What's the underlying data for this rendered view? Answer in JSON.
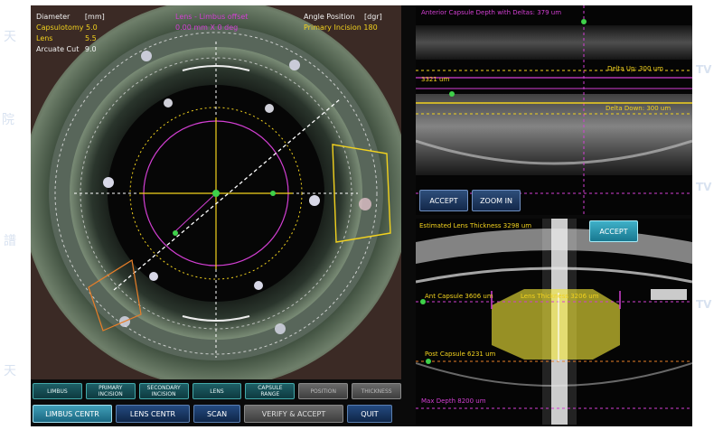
{
  "overlay": {
    "left": {
      "diameter_label": "Diameter",
      "diameter_unit": "[mm]",
      "capsulotomy": "Capsulotomy 5.0",
      "lens_label": "Lens",
      "lens_value": "5.5",
      "arcuate_label": "Arcuate Cut",
      "arcuate_value": "9.0"
    },
    "center": {
      "title": "Lens - Limbus offset",
      "value": "0.00 mm X 0 deg"
    },
    "right": {
      "angle_label": "Angle Position",
      "angle_unit": "[dgr]",
      "incision": "Primary Incision 180"
    }
  },
  "top_panel": {
    "title": "Anterior Capsule Depth with Deltas: 379 um",
    "marker_3321": "3321 um",
    "delta_up": "Delta Up: 300 um",
    "delta_down": "Delta Down: 300 um",
    "accept": "ACCEPT",
    "zoom": "ZOOM IN"
  },
  "bottom_panel": {
    "title": "Estimated Lens Thickness 3298 um",
    "accept": "ACCEPT",
    "ant_capsule": "Ant Capsule 3606 um",
    "lens_thickness": "Lens Thickness 3206 um",
    "post_capsule": "Post Capsule 6231 um",
    "max_depth": "Max Depth 8200 um"
  },
  "toolbar_row1": [
    {
      "label": "LIMBUS",
      "enabled": true
    },
    {
      "label": "PRIMARY\nINCISION",
      "enabled": true
    },
    {
      "label": "SECONDARY\nINCISION",
      "enabled": true
    },
    {
      "label": "LENS",
      "enabled": true
    },
    {
      "label": "CAPSULE\nRANGE",
      "enabled": true
    },
    {
      "label": "POSITION",
      "enabled": false
    },
    {
      "label": "THICKNESS",
      "enabled": false
    }
  ],
  "toolbar_row2": {
    "limbus_centr": "LIMBUS CENTR",
    "lens_centr": "LENS CENTR",
    "scan": "SCAN",
    "verify": "VERIFY & ACCEPT",
    "quit": "QUIT"
  },
  "watermark": [
    "天",
    "院",
    "譜",
    "天",
    "TV",
    "TV",
    "TV"
  ],
  "colors": {
    "magenta": "#d33fd3",
    "yellow": "#f2d21e",
    "green": "#3fd04a",
    "button_blue": "#244a80",
    "button_teal": "#1e5f66"
  }
}
